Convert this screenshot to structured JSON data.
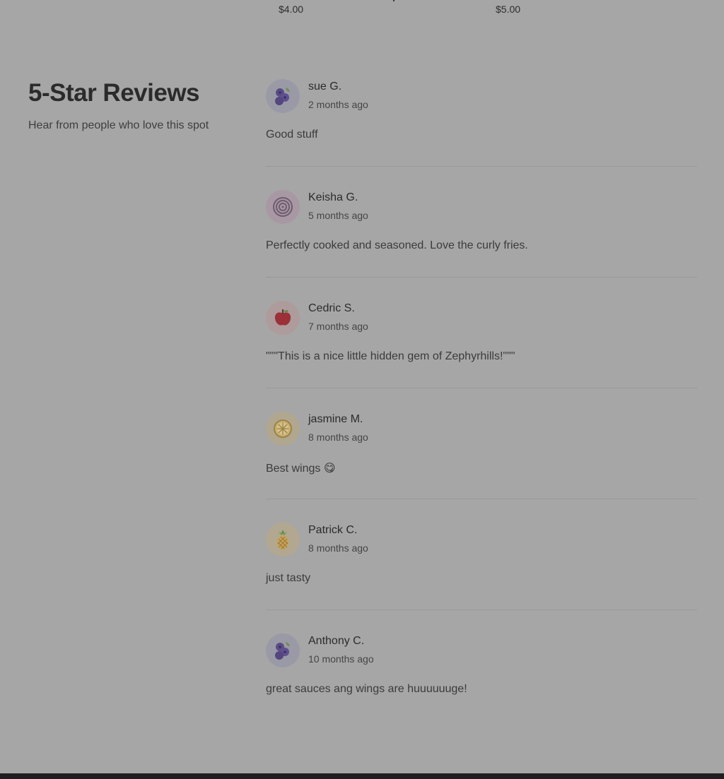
{
  "top_prices": [
    "$4.00",
    "$5.00"
  ],
  "section": {
    "title": "5-Star Reviews",
    "subtitle": "Hear from people who love this spot"
  },
  "reviews": [
    {
      "name": "sue G.",
      "time": "2 months ago",
      "text": "Good stuff",
      "avatar": "blueberry-icon",
      "avatar_bg": "#9a9aa6"
    },
    {
      "name": "Keisha G.",
      "time": "5 months ago",
      "text": "Perfectly cooked and seasoned. Love the curly fries.",
      "avatar": "onion-icon",
      "avatar_bg": "#a898a3"
    },
    {
      "name": "Cedric S.",
      "time": "7 months ago",
      "text": "\"\"\"This is a nice little hidden gem of Zephyrhills!\"\"\"",
      "avatar": "apple-icon",
      "avatar_bg": "#ae9b9b"
    },
    {
      "name": "jasmine M.",
      "time": "8 months ago",
      "text": "Best wings 😋",
      "avatar": "lemon-icon",
      "avatar_bg": "#b1a78f"
    },
    {
      "name": "Patrick C.",
      "time": "8 months ago",
      "text": "just tasty",
      "avatar": "pineapple-icon",
      "avatar_bg": "#b2a790"
    },
    {
      "name": "Anthony C.",
      "time": "10 months ago",
      "text": "great sauces ang wings are huuuuuuge!",
      "avatar": "blueberry-icon",
      "avatar_bg": "#9a9aa6"
    }
  ]
}
